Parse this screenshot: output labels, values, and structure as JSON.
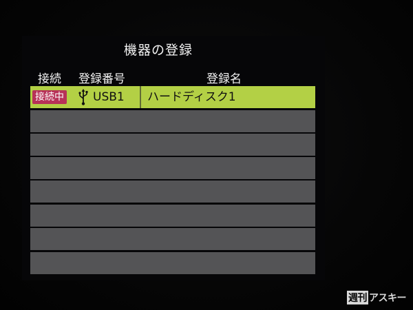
{
  "screen": {
    "title": "機器の登録"
  },
  "columns": {
    "connection": "接続",
    "number": "登録番号",
    "name": "登録名"
  },
  "rows": [
    {
      "status": "接続中",
      "icon": "usb-icon",
      "number": "USB1",
      "name": "ハードディスク1",
      "selected": true
    },
    {
      "status": "",
      "number": "",
      "name": "",
      "selected": false
    },
    {
      "status": "",
      "number": "",
      "name": "",
      "selected": false
    },
    {
      "status": "",
      "number": "",
      "name": "",
      "selected": false
    },
    {
      "status": "",
      "number": "",
      "name": "",
      "selected": false
    },
    {
      "status": "",
      "number": "",
      "name": "",
      "selected": false
    },
    {
      "status": "",
      "number": "",
      "name": "",
      "selected": false
    },
    {
      "status": "",
      "number": "",
      "name": "",
      "selected": false
    }
  ],
  "watermark": {
    "prefix": "週刊",
    "text": "アスキー"
  },
  "colors": {
    "selected_row": "#b3d045",
    "empty_row": "#545456",
    "status_badge": "#b73258"
  }
}
